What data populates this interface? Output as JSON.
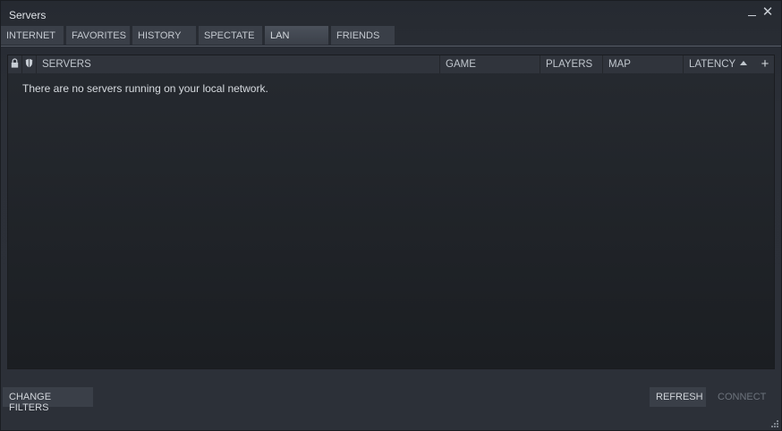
{
  "window": {
    "title": "Servers"
  },
  "tabs": [
    {
      "label": "INTERNET",
      "active": false
    },
    {
      "label": "FAVORITES",
      "active": false
    },
    {
      "label": "HISTORY",
      "active": false
    },
    {
      "label": "SPECTATE",
      "active": false
    },
    {
      "label": "LAN",
      "active": true
    },
    {
      "label": "FRIENDS",
      "active": false
    }
  ],
  "table": {
    "icons": [
      "lock-icon",
      "shield-icon"
    ],
    "columns": {
      "servers": "SERVERS",
      "game": "GAME",
      "players": "PLAYERS",
      "map": "MAP",
      "latency": "LATENCY"
    },
    "sort_column": "LATENCY",
    "sort_direction": "ascending",
    "empty_message": "There are no servers running on your local network."
  },
  "footer": {
    "change_filters": "CHANGE FILTERS",
    "refresh": "REFRESH",
    "connect": "CONNECT"
  }
}
